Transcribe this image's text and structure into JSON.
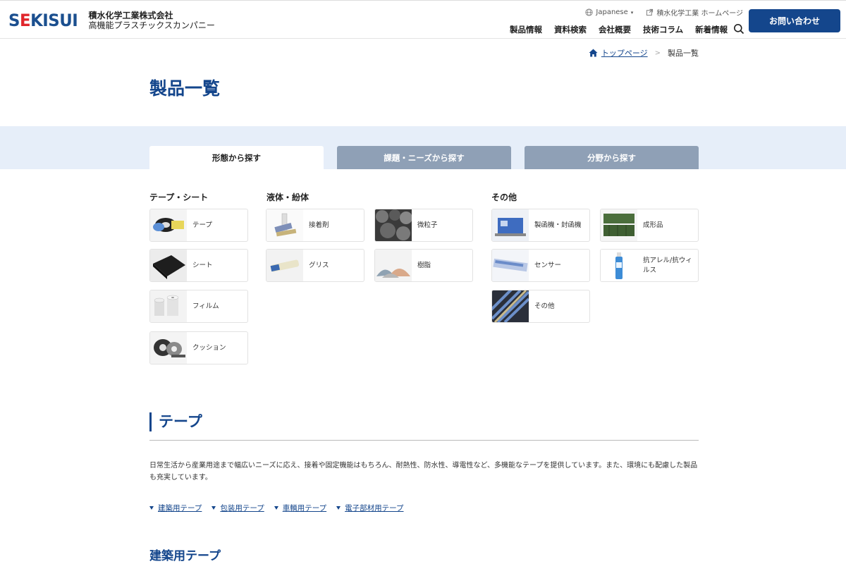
{
  "header": {
    "logo_mark": "SEKISUI",
    "company_line1": "積水化学工業株式会社",
    "company_line2": "高機能プラスチックスカンパニー",
    "language": "Japanese",
    "corp_link": "積水化学工業 ホームページ",
    "nav": [
      "製品情報",
      "資料検索",
      "会社概要",
      "技術コラム",
      "新着情報"
    ],
    "contact": "お問い合わせ"
  },
  "breadcrumb": {
    "home": "トップページ",
    "current": "製品一覧"
  },
  "page_title": "製品一覧",
  "tabs": [
    "形態から探す",
    "課題・ニーズから探す",
    "分野から探す"
  ],
  "categories": {
    "tape_sheet": {
      "heading": "テープ・シート",
      "items": [
        "テープ",
        "シート",
        "フィルム",
        "クッション"
      ]
    },
    "liquid_powder": {
      "heading": "液体・紛体",
      "items": [
        "接着剤",
        "微粒子",
        "グリス",
        "樹脂"
      ]
    },
    "other": {
      "heading": "その他",
      "items": [
        "製函機・封函機",
        "成形品",
        "センサー",
        "抗アレル/抗ウィルス",
        "その他"
      ]
    }
  },
  "section": {
    "title": "テープ",
    "description": "日常生活から産業用途まで幅広いニーズに応え、接着や固定機能はもちろん、耐熱性、防水性、導電性など、多機能なテープを提供しています。また、環境にも配慮した製品も充実しています。",
    "anchors": [
      "建築用テープ",
      "包装用テープ",
      "車輌用テープ",
      "電子部材用テープ"
    ],
    "sub_title": "建築用テープ"
  }
}
